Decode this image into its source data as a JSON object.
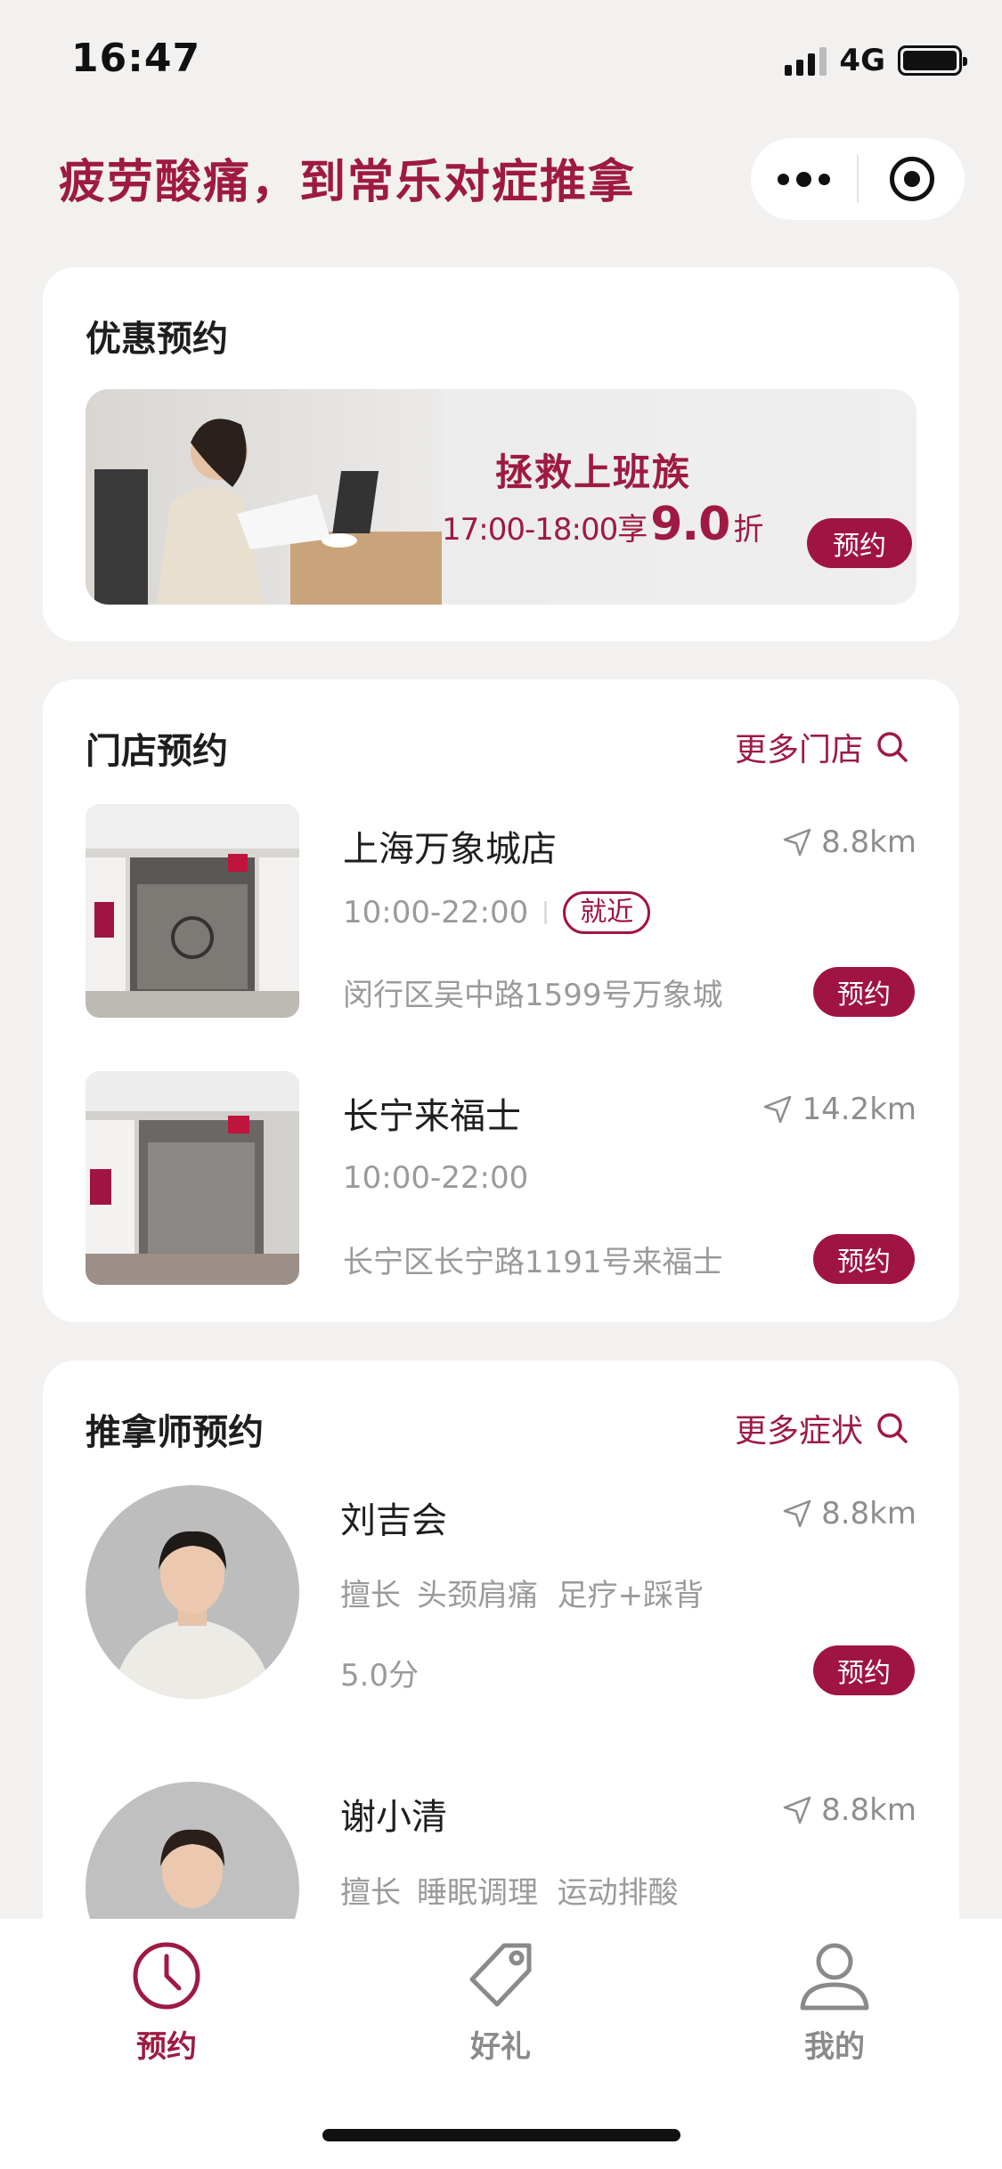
{
  "status_bar": {
    "time": "16:47",
    "network": "4G",
    "battery_level": 1.0
  },
  "header": {
    "title": "疲劳酸痛，到常乐对症推拿"
  },
  "promo": {
    "section_title": "优惠预约",
    "banner_title": "拯救上班族",
    "banner_time": "17:00-18:00享",
    "banner_discount": "9.0",
    "banner_unit": "折",
    "book_label": "预约"
  },
  "stores": {
    "section_title": "门店预约",
    "more_label": "更多门店",
    "items": [
      {
        "name": "上海万象城店",
        "distance": "8.8km",
        "hours": "10:00-22:00",
        "tag": "就近",
        "address": "闵行区吴中路1599号万象城",
        "book_label": "预约"
      },
      {
        "name": "长宁来福士",
        "distance": "14.2km",
        "hours": "10:00-22:00",
        "tag": "",
        "address": "长宁区长宁路1191号来福士",
        "book_label": "预约"
      }
    ]
  },
  "therapists": {
    "section_title": "推拿师预约",
    "more_label": "更多症状",
    "items": [
      {
        "name": "刘吉会",
        "distance": "8.8km",
        "specialty_label": "擅长",
        "specialties": "头颈肩痛  足疗+踩背",
        "score": "5.0分",
        "book_label": "预约"
      },
      {
        "name": "谢小清",
        "distance": "8.8km",
        "specialty_label": "擅长",
        "specialties": "睡眠调理  运动排酸"
      }
    ]
  },
  "tabbar": {
    "tabs": [
      {
        "label": "预约",
        "icon": "clock-icon",
        "active": true
      },
      {
        "label": "好礼",
        "icon": "tag-icon",
        "active": false
      },
      {
        "label": "我的",
        "icon": "user-icon",
        "active": false
      }
    ]
  },
  "colors": {
    "brand": "#a01444",
    "background": "#f2f1f0",
    "muted_text": "#9a9a9a"
  }
}
